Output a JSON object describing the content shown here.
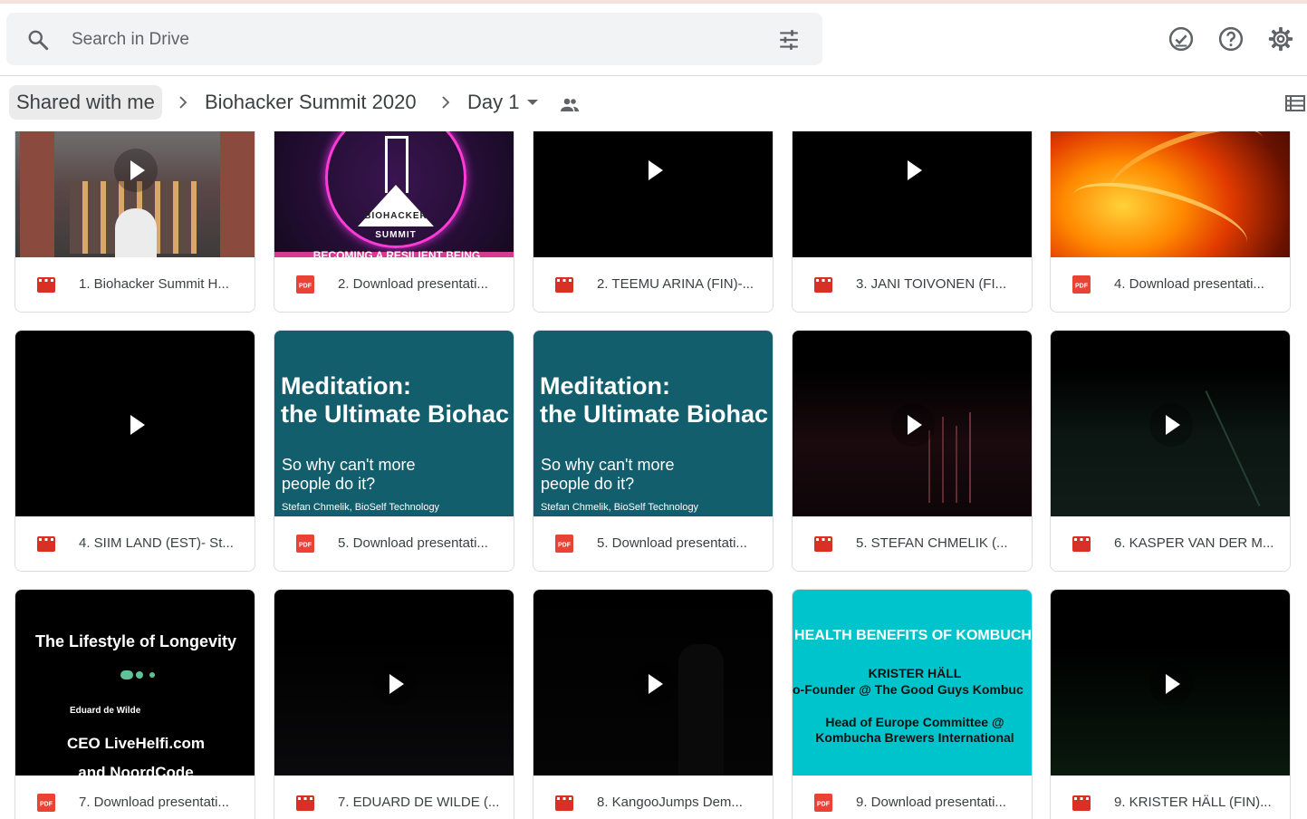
{
  "search": {
    "placeholder": "Search in Drive"
  },
  "breadcrumb": {
    "shared": "Shared with me",
    "folder": "Biohacker Summit 2020",
    "current": "Day 1"
  },
  "thumb_text": {
    "biohacker_logo": "BIOHACKER",
    "biohacker_summit": "SUMMIT",
    "biohacker_tagline": "BECOMING A RESILIENT BEING",
    "meditation_line1": "Meditation:",
    "meditation_line2": "the Ultimate Biohac",
    "meditation_sub1": "So why can't more",
    "meditation_sub2": "people do it?",
    "meditation_author": "Stefan Chmelik, BioSelf Technology",
    "longevity_title": "The Lifestyle of Longevity",
    "longevity_name": "Eduard de Wilde",
    "longevity_ceo": "CEO LiveHelfi.com",
    "longevity_and": "and NoordCode",
    "kombucha_title": "HEALTH BENEFITS OF KOMBUCH",
    "kombucha_name": "KRISTER HÄLL",
    "kombucha_role": "o-Founder @ The Good Guys Kombuc",
    "kombucha_head1": "Head of Europe Committee @",
    "kombucha_head2": "Kombucha Brewers International"
  },
  "files": [
    {
      "name": "1. Biohacker Summit H...",
      "type": "video"
    },
    {
      "name": "2. Download presentati...",
      "type": "pdf"
    },
    {
      "name": "2. TEEMU ARINA (FIN)-...",
      "type": "video"
    },
    {
      "name": "3. JANI TOIVONEN (FI...",
      "type": "video"
    },
    {
      "name": "4. Download presentati...",
      "type": "pdf"
    },
    {
      "name": "4. SIIM LAND (EST)- St...",
      "type": "video"
    },
    {
      "name": "5. Download presentati...",
      "type": "pdf"
    },
    {
      "name": "5. Download presentati...",
      "type": "pdf"
    },
    {
      "name": "5. STEFAN CHMELIK (...",
      "type": "video"
    },
    {
      "name": "6. KASPER VAN DER M...",
      "type": "video"
    },
    {
      "name": "7. Download presentati...",
      "type": "pdf"
    },
    {
      "name": "7. EDUARD DE WILDE (...",
      "type": "video"
    },
    {
      "name": "8. KangooJumps Dem...",
      "type": "video"
    },
    {
      "name": "9. Download presentati...",
      "type": "pdf"
    },
    {
      "name": "9. KRISTER HÄLL (FIN)...",
      "type": "video"
    }
  ],
  "file_type_labels": {
    "pdf": "PDF"
  },
  "colors": {
    "video_icon": "#d93025",
    "pdf_icon": "#ea4335",
    "teal_slide": "#135e6c",
    "cyan_slide": "#00c4cc",
    "accent": "#1a73e8"
  }
}
